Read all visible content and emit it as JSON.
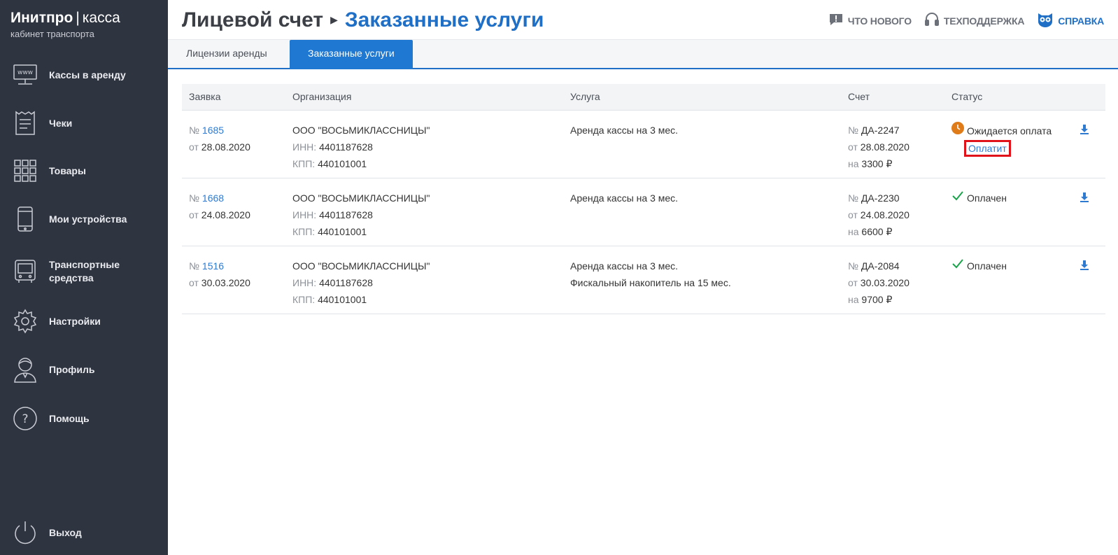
{
  "brand": {
    "name": "Инитпро",
    "product": "касса",
    "subtitle": "кабинет транспорта"
  },
  "sidebar": {
    "items": [
      {
        "label": "Кассы в аренду",
        "icon": "www-terminal-icon"
      },
      {
        "label": "Чеки",
        "icon": "receipt-icon"
      },
      {
        "label": "Товары",
        "icon": "grid-icon"
      },
      {
        "label": "Мои устройства",
        "icon": "phone-icon"
      },
      {
        "label": "Транспортные средства",
        "icon": "bus-icon"
      },
      {
        "label": "Настройки",
        "icon": "gear-icon"
      },
      {
        "label": "Профиль",
        "icon": "user-icon"
      },
      {
        "label": "Помощь",
        "icon": "help-icon"
      },
      {
        "label": "Выход",
        "icon": "power-icon"
      }
    ]
  },
  "header": {
    "title_parent": "Лицевой счет",
    "title_current": "Заказанные услуги",
    "links": {
      "news": "ЧТО НОВОГО",
      "support": "ТЕХПОДДЕРЖКА",
      "help": "СПРАВКА"
    }
  },
  "tabs": [
    {
      "label": "Лицензии аренды",
      "active": false
    },
    {
      "label": "Заказанные услуги",
      "active": true
    }
  ],
  "table": {
    "columns": [
      "Заявка",
      "Организация",
      "Услуга",
      "Счет",
      "Статус"
    ],
    "rows": [
      {
        "order_prefix": "№",
        "order_no": "1685",
        "order_date_prefix": "от",
        "order_date": "28.08.2020",
        "org": "ООО \"ВОСЬМИКЛАССНИЦЫ\"",
        "inn_label": "ИНН:",
        "inn": "4401187628",
        "kpp_label": "КПП:",
        "kpp": "440101001",
        "services": [
          "Аренда кассы на 3 мес."
        ],
        "invoice_prefix": "№",
        "invoice_no": "ДА-2247",
        "invoice_date_prefix": "от",
        "invoice_date": "28.08.2020",
        "amount_prefix": "на",
        "amount": "3300 ₽",
        "status": "Ожидается оплата",
        "status_type": "pending",
        "pay_label": "Оплатит"
      },
      {
        "order_prefix": "№",
        "order_no": "1668",
        "order_date_prefix": "от",
        "order_date": "24.08.2020",
        "org": "ООО \"ВОСЬМИКЛАССНИЦЫ\"",
        "inn_label": "ИНН:",
        "inn": "4401187628",
        "kpp_label": "КПП:",
        "kpp": "440101001",
        "services": [
          "Аренда кассы на 3 мес."
        ],
        "invoice_prefix": "№",
        "invoice_no": "ДА-2230",
        "invoice_date_prefix": "от",
        "invoice_date": "24.08.2020",
        "amount_prefix": "на",
        "amount": "6600 ₽",
        "status": "Оплачен",
        "status_type": "paid"
      },
      {
        "order_prefix": "№",
        "order_no": "1516",
        "order_date_prefix": "от",
        "order_date": "30.03.2020",
        "org": "ООО \"ВОСЬМИКЛАССНИЦЫ\"",
        "inn_label": "ИНН:",
        "inn": "4401187628",
        "kpp_label": "КПП:",
        "kpp": "440101001",
        "services": [
          "Аренда кассы на 3 мес.",
          "Фискальный накопитель на 15 мес."
        ],
        "invoice_prefix": "№",
        "invoice_no": "ДА-2084",
        "invoice_date_prefix": "от",
        "invoice_date": "30.03.2020",
        "amount_prefix": "на",
        "amount": "9700 ₽",
        "status": "Оплачен",
        "status_type": "paid"
      }
    ]
  },
  "colors": {
    "sidebar_bg": "#2f3441",
    "accent": "#1f78d1",
    "link": "#2e7ad1",
    "pending": "#e07b1a",
    "paid": "#1aa34a",
    "highlight": "#e0131a"
  }
}
